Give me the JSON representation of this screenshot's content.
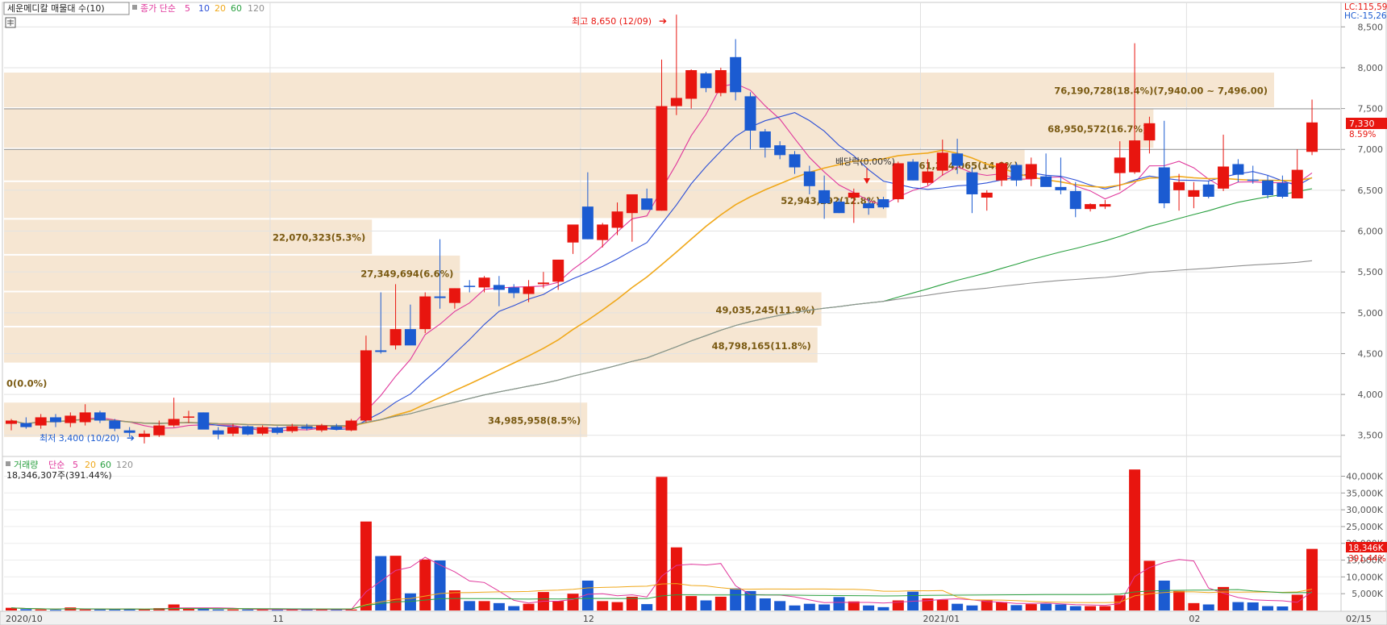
{
  "header": {
    "title_box": "세운메디칼 매물대 수(10)",
    "ma_label": "종가 단순",
    "ma_periods": [
      "5",
      "10",
      "20",
      "60",
      "120"
    ],
    "right_top_lc": "LC:115,59",
    "right_top_hc": "HC:-15,26"
  },
  "colors": {
    "up": "#e8150f",
    "down": "#1b5bd1",
    "ma5": "#e0389c",
    "ma10": "#2c4fd6",
    "ma20": "#f0a81a",
    "ma60": "#2aa040",
    "ma120": "#909090",
    "volume_profile": "#f6e6d2",
    "profile_text": "#7a5a12"
  },
  "price_axis": {
    "ticks": [
      "8,500",
      "8,000",
      "7,500",
      "7,000",
      "6,500",
      "6,000",
      "5,500",
      "5,000",
      "4,500",
      "4,000",
      "3,500"
    ],
    "current_price": "7,330",
    "current_change": "8.59%"
  },
  "volume_axis": {
    "ticks": [
      "40,000K",
      "35,000K",
      "30,000K",
      "25,000K",
      "20,000K",
      "15,000K",
      "10,000K",
      "5,000K"
    ],
    "current_volume": "18,346K",
    "current_ratio": "391.44%"
  },
  "volume_panel": {
    "title": "거래량",
    "ma_label": "단순",
    "ma_periods": [
      "5",
      "20",
      "60",
      "120"
    ],
    "summary": "18,346,307주(391.44%)"
  },
  "x_axis": {
    "labels": [
      "2020/10",
      "11",
      "12",
      "2021/01",
      "02",
      "02/15"
    ]
  },
  "annotations": {
    "high": "최고 8,650 (12/09)",
    "low": "최저 3,400 (10/20)",
    "dividend": "배당락(0.00%)"
  },
  "volume_profile_labels": [
    "76,190,728(18.4%)(7,940.00 ~ 7,496.00)",
    "68,950,572(16.7%)",
    "61,224,065(14.8%)",
    "52,943,292(12.8%)",
    "22,070,323(5.3%)",
    "27,349,694(6.6%)",
    "49,035,245(11.9%)",
    "48,798,165(11.8%)",
    "0(0.0%)",
    "34,985,958(8.5%)"
  ],
  "chart_data": {
    "type": "candlestick",
    "price_range": [
      3300,
      8750
    ],
    "volume_range": [
      0,
      43000
    ],
    "volume_unit": "K",
    "candles": [
      {
        "o": 3640,
        "h": 3700,
        "l": 3560,
        "c": 3680
      },
      {
        "o": 3650,
        "h": 3720,
        "l": 3580,
        "c": 3600
      },
      {
        "o": 3620,
        "h": 3760,
        "l": 3580,
        "c": 3720
      },
      {
        "o": 3720,
        "h": 3760,
        "l": 3600,
        "c": 3660
      },
      {
        "o": 3650,
        "h": 3780,
        "l": 3600,
        "c": 3740
      },
      {
        "o": 3660,
        "h": 3880,
        "l": 3620,
        "c": 3780
      },
      {
        "o": 3780,
        "h": 3800,
        "l": 3650,
        "c": 3680
      },
      {
        "o": 3680,
        "h": 3700,
        "l": 3550,
        "c": 3580
      },
      {
        "o": 3560,
        "h": 3600,
        "l": 3480,
        "c": 3530
      },
      {
        "o": 3480,
        "h": 3560,
        "l": 3400,
        "c": 3520
      },
      {
        "o": 3500,
        "h": 3680,
        "l": 3480,
        "c": 3620
      },
      {
        "o": 3620,
        "h": 3960,
        "l": 3600,
        "c": 3700
      },
      {
        "o": 3720,
        "h": 3800,
        "l": 3650,
        "c": 3730
      },
      {
        "o": 3780,
        "h": 3780,
        "l": 3580,
        "c": 3570
      },
      {
        "o": 3560,
        "h": 3600,
        "l": 3450,
        "c": 3510
      },
      {
        "o": 3520,
        "h": 3640,
        "l": 3490,
        "c": 3600
      },
      {
        "o": 3610,
        "h": 3620,
        "l": 3500,
        "c": 3510
      },
      {
        "o": 3520,
        "h": 3620,
        "l": 3500,
        "c": 3600
      },
      {
        "o": 3590,
        "h": 3610,
        "l": 3510,
        "c": 3530
      },
      {
        "o": 3550,
        "h": 3640,
        "l": 3530,
        "c": 3610
      },
      {
        "o": 3610,
        "h": 3640,
        "l": 3560,
        "c": 3580
      },
      {
        "o": 3560,
        "h": 3640,
        "l": 3540,
        "c": 3620
      },
      {
        "o": 3610,
        "h": 3640,
        "l": 3560,
        "c": 3570
      },
      {
        "o": 3560,
        "h": 3700,
        "l": 3550,
        "c": 3680
      },
      {
        "o": 3680,
        "h": 4720,
        "l": 3660,
        "c": 4540
      },
      {
        "o": 4540,
        "h": 5250,
        "l": 4500,
        "c": 4520
      },
      {
        "o": 4600,
        "h": 5350,
        "l": 4550,
        "c": 4800
      },
      {
        "o": 4800,
        "h": 5100,
        "l": 4700,
        "c": 4600
      },
      {
        "o": 4800,
        "h": 5250,
        "l": 4750,
        "c": 5200
      },
      {
        "o": 5200,
        "h": 5900,
        "l": 5050,
        "c": 5180
      },
      {
        "o": 5120,
        "h": 5300,
        "l": 5050,
        "c": 5300
      },
      {
        "o": 5330,
        "h": 5400,
        "l": 5250,
        "c": 5320
      },
      {
        "o": 5310,
        "h": 5450,
        "l": 5250,
        "c": 5430
      },
      {
        "o": 5340,
        "h": 5450,
        "l": 5080,
        "c": 5280
      },
      {
        "o": 5310,
        "h": 5350,
        "l": 5180,
        "c": 5240
      },
      {
        "o": 5230,
        "h": 5400,
        "l": 5130,
        "c": 5320
      },
      {
        "o": 5350,
        "h": 5500,
        "l": 5300,
        "c": 5370
      },
      {
        "o": 5380,
        "h": 5650,
        "l": 5280,
        "c": 5650
      },
      {
        "o": 5860,
        "h": 6000,
        "l": 5720,
        "c": 6080
      },
      {
        "o": 6300,
        "h": 6720,
        "l": 5900,
        "c": 5900
      },
      {
        "o": 5890,
        "h": 6100,
        "l": 5800,
        "c": 6080
      },
      {
        "o": 6040,
        "h": 6350,
        "l": 5950,
        "c": 6240
      },
      {
        "o": 6220,
        "h": 6420,
        "l": 5870,
        "c": 6450
      },
      {
        "o": 6400,
        "h": 6520,
        "l": 6300,
        "c": 6260
      },
      {
        "o": 6250,
        "h": 8100,
        "l": 6250,
        "c": 7530
      },
      {
        "o": 7530,
        "h": 8650,
        "l": 7420,
        "c": 7630
      },
      {
        "o": 7620,
        "h": 7980,
        "l": 7500,
        "c": 7970
      },
      {
        "o": 7930,
        "h": 7950,
        "l": 7700,
        "c": 7750
      },
      {
        "o": 7690,
        "h": 8000,
        "l": 7650,
        "c": 7970
      },
      {
        "o": 8130,
        "h": 8350,
        "l": 7600,
        "c": 7700
      },
      {
        "o": 7650,
        "h": 7700,
        "l": 7000,
        "c": 7230
      },
      {
        "o": 7220,
        "h": 7250,
        "l": 6900,
        "c": 7020
      },
      {
        "o": 7050,
        "h": 7100,
        "l": 6880,
        "c": 6930
      },
      {
        "o": 6940,
        "h": 6980,
        "l": 6700,
        "c": 6780
      },
      {
        "o": 6730,
        "h": 6800,
        "l": 6450,
        "c": 6550
      },
      {
        "o": 6500,
        "h": 6680,
        "l": 6150,
        "c": 6340
      },
      {
        "o": 6360,
        "h": 6400,
        "l": 6220,
        "c": 6220
      },
      {
        "o": 6410,
        "h": 6520,
        "l": 6100,
        "c": 6470
      },
      {
        "o": 6340,
        "h": 6400,
        "l": 6200,
        "c": 6280
      },
      {
        "o": 6390,
        "h": 6420,
        "l": 6270,
        "c": 6290
      },
      {
        "o": 6390,
        "h": 6850,
        "l": 6350,
        "c": 6830
      },
      {
        "o": 6850,
        "h": 6880,
        "l": 6620,
        "c": 6620
      },
      {
        "o": 6590,
        "h": 6880,
        "l": 6560,
        "c": 6730
      },
      {
        "o": 6740,
        "h": 7120,
        "l": 6680,
        "c": 6960
      },
      {
        "o": 6950,
        "h": 7130,
        "l": 6700,
        "c": 6800
      },
      {
        "o": 6720,
        "h": 6780,
        "l": 6220,
        "c": 6450
      },
      {
        "o": 6410,
        "h": 6500,
        "l": 6250,
        "c": 6470
      },
      {
        "o": 6620,
        "h": 6850,
        "l": 6550,
        "c": 6830
      },
      {
        "o": 6810,
        "h": 6840,
        "l": 6550,
        "c": 6620
      },
      {
        "o": 6640,
        "h": 6900,
        "l": 6550,
        "c": 6820
      },
      {
        "o": 6670,
        "h": 6950,
        "l": 6560,
        "c": 6540
      },
      {
        "o": 6540,
        "h": 6900,
        "l": 6450,
        "c": 6500
      },
      {
        "o": 6490,
        "h": 6600,
        "l": 6170,
        "c": 6270
      },
      {
        "o": 6270,
        "h": 6340,
        "l": 6240,
        "c": 6330
      },
      {
        "o": 6300,
        "h": 6380,
        "l": 6270,
        "c": 6330
      },
      {
        "o": 6710,
        "h": 7100,
        "l": 6500,
        "c": 6900
      },
      {
        "o": 6720,
        "h": 8300,
        "l": 6700,
        "c": 7110
      },
      {
        "o": 7110,
        "h": 7400,
        "l": 6950,
        "c": 7320
      },
      {
        "o": 6780,
        "h": 7350,
        "l": 6280,
        "c": 6340
      },
      {
        "o": 6500,
        "h": 6700,
        "l": 6250,
        "c": 6600
      },
      {
        "o": 6420,
        "h": 6600,
        "l": 6280,
        "c": 6500
      },
      {
        "o": 6570,
        "h": 6620,
        "l": 6400,
        "c": 6420
      },
      {
        "o": 6520,
        "h": 7180,
        "l": 6490,
        "c": 6790
      },
      {
        "o": 6820,
        "h": 6880,
        "l": 6600,
        "c": 6690
      },
      {
        "o": 6630,
        "h": 6800,
        "l": 6580,
        "c": 6620
      },
      {
        "o": 6620,
        "h": 6680,
        "l": 6400,
        "c": 6440
      },
      {
        "o": 6590,
        "h": 6680,
        "l": 6400,
        "c": 6420
      },
      {
        "o": 6400,
        "h": 7000,
        "l": 6400,
        "c": 6750
      },
      {
        "o": 6970,
        "h": 7610,
        "l": 6930,
        "c": 7330
      }
    ],
    "volumes": [
      800,
      400,
      300,
      200,
      900,
      300,
      300,
      300,
      500,
      400,
      700,
      1800,
      600,
      500,
      300,
      300,
      300,
      300,
      200,
      300,
      300,
      300,
      300,
      300,
      26500,
      16200,
      16300,
      5100,
      15200,
      14900,
      6000,
      2800,
      2800,
      2200,
      1300,
      2000,
      5500,
      2800,
      5000,
      8900,
      2800,
      2500,
      4100,
      1900,
      39800,
      18800,
      4300,
      3000,
      4100,
      6600,
      5800,
      3600,
      2800,
      1500,
      2000,
      1800,
      4000,
      2700,
      1500,
      1000,
      3000,
      5600,
      3600,
      3200,
      2000,
      1500,
      3000,
      2500,
      1600,
      1900,
      2000,
      1800,
      1300,
      1300,
      1300,
      4500,
      42000,
      14800,
      8900,
      5800,
      2200,
      1800,
      7000,
      2500,
      2400,
      1300,
      1200,
      4700,
      18346
    ],
    "volume_profile": [
      {
        "low": 7496,
        "high": 7940,
        "volume": 76190728,
        "pct": 18.4
      },
      {
        "low": 7000,
        "high": 7496,
        "volume": 68950572,
        "pct": 16.7
      },
      {
        "low": 6600,
        "high": 7000,
        "volume": 61224065,
        "pct": 14.8
      },
      {
        "low": 6140,
        "high": 6600,
        "volume": 52943292,
        "pct": 12.8
      },
      {
        "low": 5700,
        "high": 6140,
        "volume": 22070323,
        "pct": 5.3
      },
      {
        "low": 5250,
        "high": 5700,
        "volume": 27349694,
        "pct": 6.6
      },
      {
        "low": 4820,
        "high": 5250,
        "volume": 49035245,
        "pct": 11.9
      },
      {
        "low": 4370,
        "high": 4820,
        "volume": 48798165,
        "pct": 11.8
      },
      {
        "low": 3900,
        "high": 4370,
        "volume": 0,
        "pct": 0.0
      },
      {
        "low": 3460,
        "high": 3900,
        "volume": 34985958,
        "pct": 8.5
      }
    ]
  }
}
